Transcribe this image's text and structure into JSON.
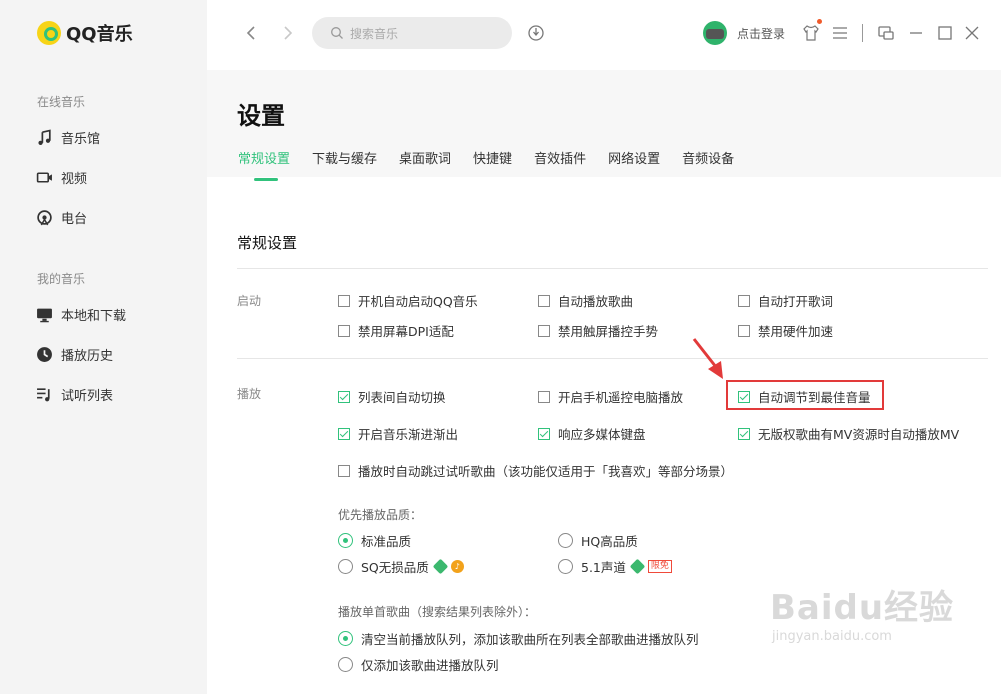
{
  "app": {
    "name": "QQ音乐"
  },
  "sidebar": {
    "groups": [
      {
        "title": "在线音乐",
        "items": [
          {
            "label": "音乐馆",
            "icon": "music-note-icon"
          },
          {
            "label": "视频",
            "icon": "video-icon"
          },
          {
            "label": "电台",
            "icon": "radio-icon"
          }
        ]
      },
      {
        "title": "我的音乐",
        "items": [
          {
            "label": "本地和下载",
            "icon": "monitor-icon"
          },
          {
            "label": "播放历史",
            "icon": "clock-icon"
          },
          {
            "label": "试听列表",
            "icon": "playlist-icon"
          }
        ]
      }
    ]
  },
  "topbar": {
    "search_placeholder": "搜索音乐",
    "login_label": "点击登录"
  },
  "page": {
    "title": "设置",
    "tabs": [
      "常规设置",
      "下载与缓存",
      "桌面歌词",
      "快捷键",
      "音效插件",
      "网络设置",
      "音频设备"
    ],
    "active_tab": "常规设置",
    "section_title": "常规设置"
  },
  "startup": {
    "label": "启动",
    "options": [
      {
        "label": "开机自动启动QQ音乐",
        "checked": false
      },
      {
        "label": "自动播放歌曲",
        "checked": false
      },
      {
        "label": "自动打开歌词",
        "checked": false
      },
      {
        "label": "禁用屏幕DPI适配",
        "checked": false
      },
      {
        "label": "禁用触屏播控手势",
        "checked": false
      },
      {
        "label": "禁用硬件加速",
        "checked": false
      }
    ]
  },
  "playback": {
    "label": "播放",
    "options": [
      {
        "label": "列表间自动切换",
        "checked": true
      },
      {
        "label": "开启手机遥控电脑播放",
        "checked": false
      },
      {
        "label": "自动调节到最佳音量",
        "checked": true
      },
      {
        "label": "开启音乐渐进渐出",
        "checked": true
      },
      {
        "label": "响应多媒体键盘",
        "checked": true
      },
      {
        "label": "无版权歌曲有MV资源时自动播放MV",
        "checked": true
      },
      {
        "label": "播放时自动跳过试听歌曲（该功能仅适用于「我喜欢」等部分场景）",
        "checked": false
      }
    ],
    "quality_title": "优先播放品质：",
    "quality_options": [
      {
        "label": "标准品质",
        "selected": true
      },
      {
        "label": "HQ高品质",
        "selected": false
      },
      {
        "label": "SQ无损品质",
        "selected": false
      },
      {
        "label": "5.1声道",
        "selected": false
      }
    ],
    "limit_badge": "限免",
    "single_title": "播放单首歌曲（搜索结果列表除外）：",
    "single_options": [
      {
        "label": "清空当前播放队列，添加该歌曲所在列表全部歌曲进播放队列",
        "selected": true
      },
      {
        "label": "仅添加该歌曲进播放队列",
        "selected": false
      }
    ]
  },
  "watermark": {
    "brand": "Baidu经验",
    "url": "jingyan.baidu.com"
  },
  "colors": {
    "accent": "#31c27c",
    "highlight": "#e23a3a"
  }
}
